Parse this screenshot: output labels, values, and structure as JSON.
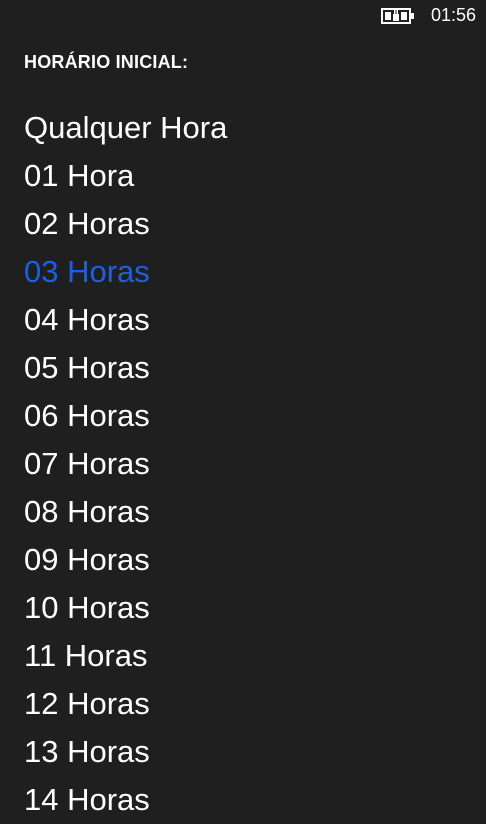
{
  "status_bar": {
    "time": "01:56",
    "battery_icon": "battery-charging-icon"
  },
  "picker": {
    "title": "HORÁRIO INICIAL:",
    "selected_index": 3,
    "accent_color": "#1d5fe0",
    "options": [
      "Qualquer Hora",
      "01 Hora",
      "02 Horas",
      "03 Horas",
      "04 Horas",
      "05 Horas",
      "06 Horas",
      "07 Horas",
      "08 Horas",
      "09 Horas",
      "10 Horas",
      "11 Horas",
      "12 Horas",
      "13 Horas",
      "14 Horas"
    ]
  }
}
